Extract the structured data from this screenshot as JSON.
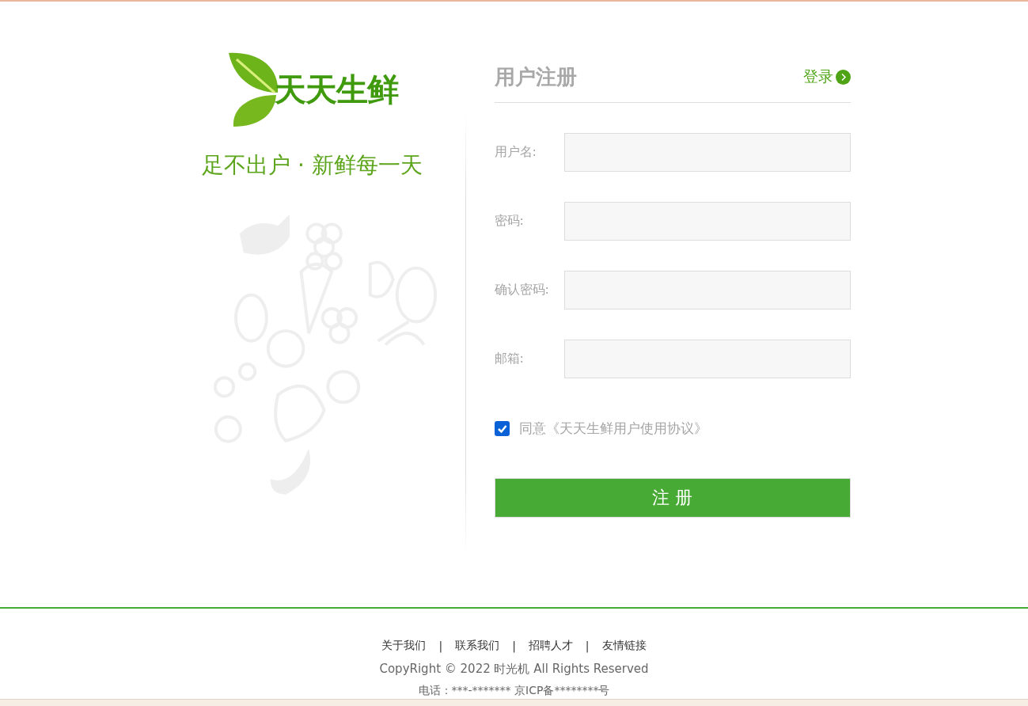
{
  "brand": {
    "logo_text": "天天生鲜",
    "slogan": "足不出户 · 新鲜每一天"
  },
  "form": {
    "title": "用户注册",
    "login_link": "登录",
    "fields": [
      {
        "label": "用户名:"
      },
      {
        "label": "密码:"
      },
      {
        "label": "确认密码:"
      },
      {
        "label": "邮箱:"
      }
    ],
    "agreement": {
      "label": "同意《天天生鲜用户使用协议》",
      "checked": true
    },
    "submit": "注 册"
  },
  "footer": {
    "links": [
      "关于我们",
      "联系我们",
      "招聘人才",
      "友情链接"
    ],
    "separator": "|",
    "copyright": "CopyRight © 2022 时光机 All Rights Reserved",
    "contact": "电话：***-******* 京ICP备********号"
  }
}
